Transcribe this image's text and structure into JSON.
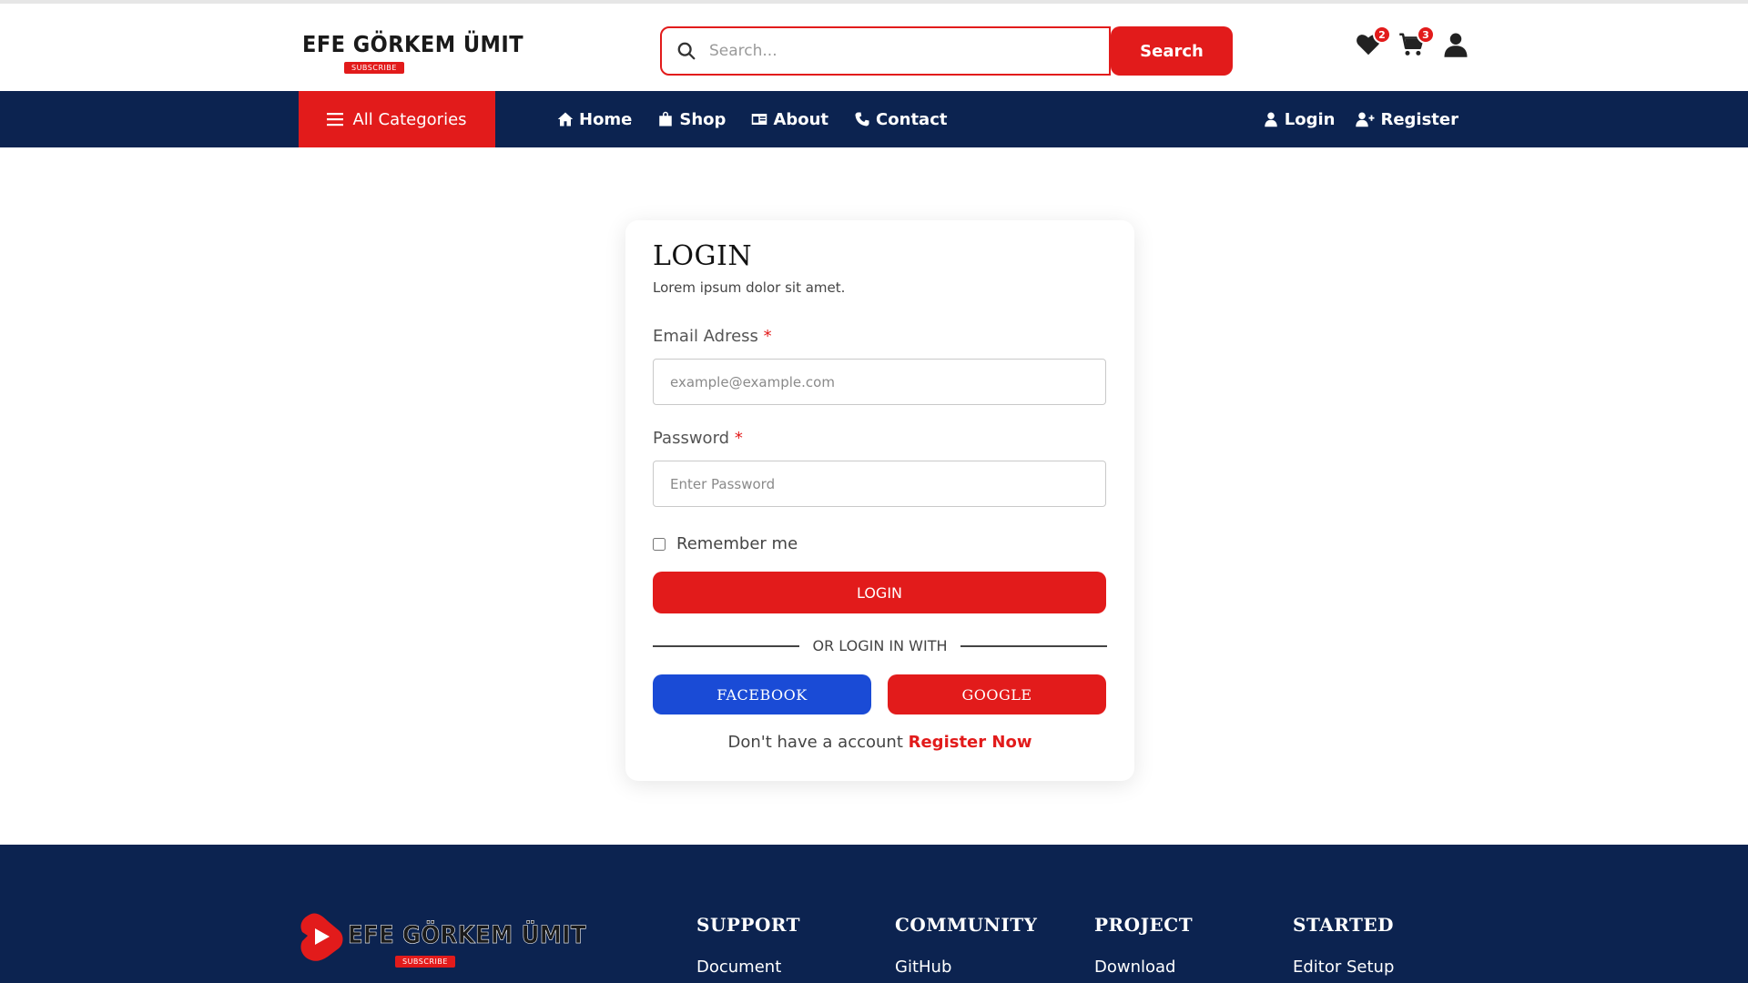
{
  "brand": {
    "name": "EFE GÖRKEM ÜMIT",
    "badge": "SUBSCRIBE",
    "accent": "#e21b1b",
    "navy": "#0c2350"
  },
  "header": {
    "search_placeholder": "Search...",
    "search_button": "Search",
    "wishlist_count": "2",
    "cart_count": "3",
    "icons": [
      "heart-icon",
      "cart-icon",
      "user-icon"
    ]
  },
  "nav": {
    "all_categories": "All Categories",
    "links": [
      {
        "label": "Home",
        "icon": "home-icon"
      },
      {
        "label": "Shop",
        "icon": "bag-icon"
      },
      {
        "label": "About",
        "icon": "id-card-icon"
      },
      {
        "label": "Contact",
        "icon": "phone-icon"
      }
    ],
    "login": "Login",
    "register": "Register"
  },
  "login_card": {
    "title": "LOGIN",
    "subtitle": "Lorem ipsum dolor sit amet.",
    "email_label": "Email Adress",
    "email_placeholder": "example@example.com",
    "password_label": "Password",
    "password_placeholder": "Enter Password",
    "required_mark": "*",
    "remember_label": "Remember me",
    "login_button": "LOGIN",
    "divider_text": "OR LOGIN IN WITH",
    "facebook_button": "FACEBOOK",
    "google_button": "GOOGLE",
    "no_account_text": "Don't have a account",
    "register_link": "Register Now"
  },
  "footer": {
    "columns": [
      {
        "heading": "SUPPORT",
        "link": "Document"
      },
      {
        "heading": "COMMUNITY",
        "link": "GitHub"
      },
      {
        "heading": "PROJECT",
        "link": "Download"
      },
      {
        "heading": "STARTED",
        "link": "Editor Setup"
      }
    ]
  }
}
